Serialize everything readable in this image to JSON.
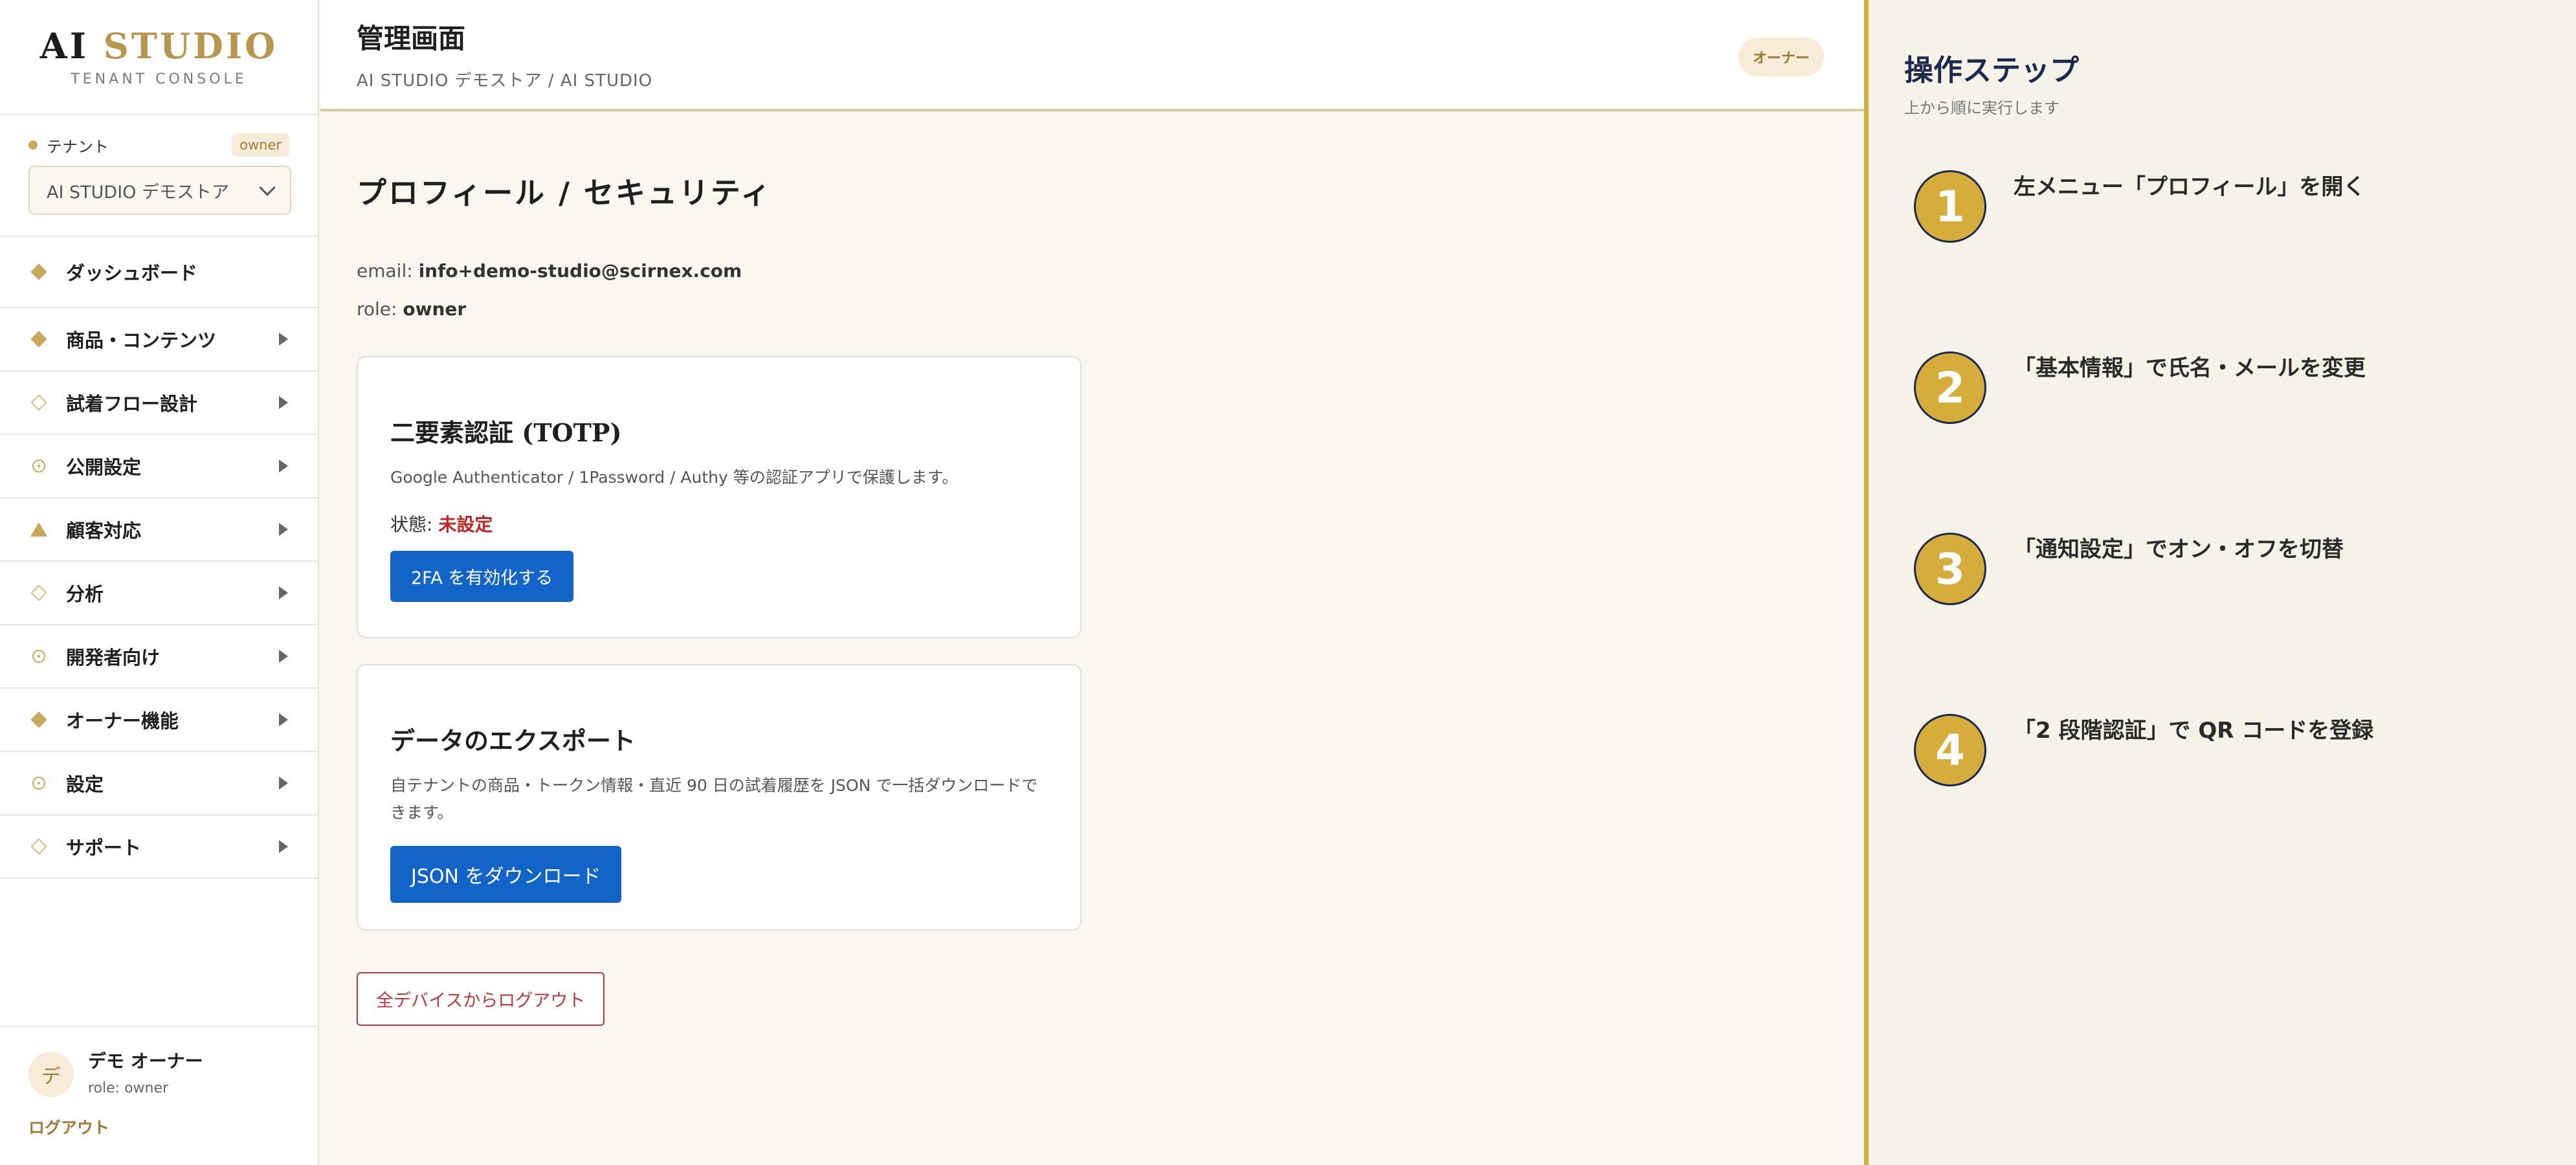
{
  "sidebar": {
    "logo": {
      "ai": "AI",
      "studio": "STUDIO",
      "subtitle": "TENANT CONSOLE"
    },
    "tenant": {
      "label": "テナント",
      "badge": "owner",
      "selected": "AI STUDIO デモストア"
    },
    "items": [
      {
        "label": "ダッシュボード",
        "icon": "diamond-filled-icon",
        "has_arrow": false
      },
      {
        "label": "商品・コンテンツ",
        "icon": "diamond-filled-icon",
        "has_arrow": true
      },
      {
        "label": "試着フロー設計",
        "icon": "diamond-outline-icon",
        "has_arrow": true
      },
      {
        "label": "公開設定",
        "icon": "circle-dot-icon",
        "has_arrow": true
      },
      {
        "label": "顧客対応",
        "icon": "triangle-icon",
        "has_arrow": true
      },
      {
        "label": "分析",
        "icon": "diamond-outline-icon",
        "has_arrow": true
      },
      {
        "label": "開発者向け",
        "icon": "circle-dot-icon",
        "has_arrow": true
      },
      {
        "label": "オーナー機能",
        "icon": "diamond-filled-icon",
        "has_arrow": true
      },
      {
        "label": "設定",
        "icon": "circle-dot-icon",
        "has_arrow": true
      },
      {
        "label": "サポート",
        "icon": "diamond-outline-icon",
        "has_arrow": true
      }
    ],
    "user": {
      "avatar": "デ",
      "name": "デモ オーナー",
      "role": "role: owner"
    },
    "logout": "ログアウト"
  },
  "header": {
    "title": "管理画面",
    "breadcrumb": "AI STUDIO デモストア / AI STUDIO",
    "role_badge": "オーナー"
  },
  "main": {
    "section_title": "プロフィール / セキュリティ",
    "email_label": "email: ",
    "email_value": "info+demo-studio@scirnex.com",
    "role_label": "role: ",
    "role_value": "owner",
    "twofa": {
      "title": "二要素認証 (TOTP)",
      "description": "Google Authenticator / 1Password / Authy 等の認証アプリで保護します。",
      "status_label": "状態: ",
      "status_value": "未設定",
      "button": "2FA を有効化する"
    },
    "export": {
      "title": "データのエクスポート",
      "description": "自テナントの商品・トークン情報・直近 90 日の試着履歴を JSON で一括ダウンロードできます。",
      "button": "JSON をダウンロード"
    },
    "logout_all": "全デバイスからログアウト"
  },
  "steps": {
    "title": "操作ステップ",
    "subtitle": "上から順に実行します",
    "items": [
      {
        "number": "1",
        "text": "左メニュー「プロフィール」を開く"
      },
      {
        "number": "2",
        "text": "「基本情報」で氏名・メールを変更"
      },
      {
        "number": "3",
        "text": "「通知設定」でオン・オフを切替"
      },
      {
        "number": "4",
        "text": "「2 段階認証」で QR コードを登録"
      }
    ]
  },
  "colors": {
    "accent_gold": "#c9a85a",
    "primary_blue": "#1264c8",
    "danger_red": "#c02626",
    "steps_border": "#d6ad3a",
    "steps_navy": "#1b2a4e"
  }
}
